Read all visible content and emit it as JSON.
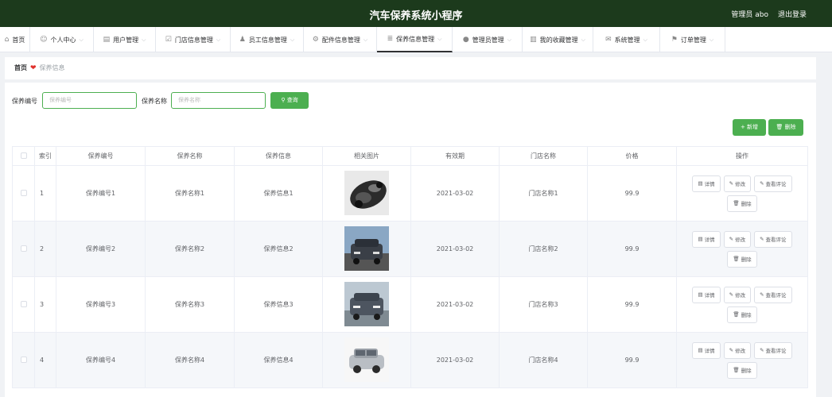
{
  "header": {
    "title": "汽车保养系统小程序",
    "admin": "管理员 abo",
    "logout": "退出登录"
  },
  "nav": [
    {
      "icon": "home-icon",
      "glyph": "⌂",
      "label": "首页",
      "dropdown": false,
      "active": false
    },
    {
      "icon": "user-icon",
      "glyph": "☺",
      "label": "个人中心",
      "dropdown": true,
      "active": false
    },
    {
      "icon": "users-icon",
      "glyph": "▤",
      "label": "用户管理",
      "dropdown": true,
      "active": false
    },
    {
      "icon": "store-icon",
      "glyph": "☑",
      "label": "门店信息管理",
      "dropdown": true,
      "active": false
    },
    {
      "icon": "staff-icon",
      "glyph": "♟",
      "label": "员工信息管理",
      "dropdown": true,
      "active": false
    },
    {
      "icon": "wrench-icon",
      "glyph": "⚙",
      "label": "配件信息管理",
      "dropdown": true,
      "active": false
    },
    {
      "icon": "maintenance-icon",
      "glyph": "≣",
      "label": "保养信息管理",
      "dropdown": true,
      "active": true
    },
    {
      "icon": "location-icon",
      "glyph": "●",
      "label": "管理员管理",
      "dropdown": true,
      "active": false
    },
    {
      "icon": "chart-icon",
      "glyph": "▥",
      "label": "我的收藏管理",
      "dropdown": true,
      "active": false
    },
    {
      "icon": "mail-icon",
      "glyph": "✉",
      "label": "系统管理",
      "dropdown": true,
      "active": false
    },
    {
      "icon": "flag-icon",
      "glyph": "⚑",
      "label": "订单管理",
      "dropdown": true,
      "active": false
    }
  ],
  "breadcrumb": {
    "home": "首页",
    "current": "保养信息"
  },
  "search": {
    "code_label": "保养编号",
    "code_placeholder": "保养编号",
    "name_label": "保养名称",
    "name_placeholder": "保养名称",
    "query_label": "查询"
  },
  "actions": {
    "add": "新增",
    "delete": "删除"
  },
  "table": {
    "headers": [
      "",
      "索引",
      "保养编号",
      "保养名称",
      "保养信息",
      "相关图片",
      "有效期",
      "门店名称",
      "价格",
      "操作"
    ],
    "rows": [
      {
        "index": "1",
        "code": "保养编号1",
        "name": "保养名称1",
        "info": "保养信息1",
        "date": "2021-03-02",
        "store": "门店名称1",
        "price": "99.9",
        "image": "car-interior-image"
      },
      {
        "index": "2",
        "code": "保养编号2",
        "name": "保养名称2",
        "info": "保养信息2",
        "date": "2021-03-02",
        "store": "门店名称2",
        "price": "99.9",
        "image": "suv-front-image"
      },
      {
        "index": "3",
        "code": "保养编号3",
        "name": "保养名称3",
        "info": "保养信息3",
        "date": "2021-03-02",
        "store": "门店名称3",
        "price": "99.9",
        "image": "suv-road-image"
      },
      {
        "index": "4",
        "code": "保养编号4",
        "name": "保养名称4",
        "info": "保养信息4",
        "date": "2021-03-02",
        "store": "门店名称4",
        "price": "99.9",
        "image": "silver-suv-image"
      }
    ],
    "row_buttons": {
      "detail": "详情",
      "edit": "修改",
      "review": "查看评论",
      "delete": "删除"
    }
  },
  "colors": {
    "header_bg": "#1c3a1c",
    "accent": "#4caf50",
    "heart": "#e0302b"
  }
}
